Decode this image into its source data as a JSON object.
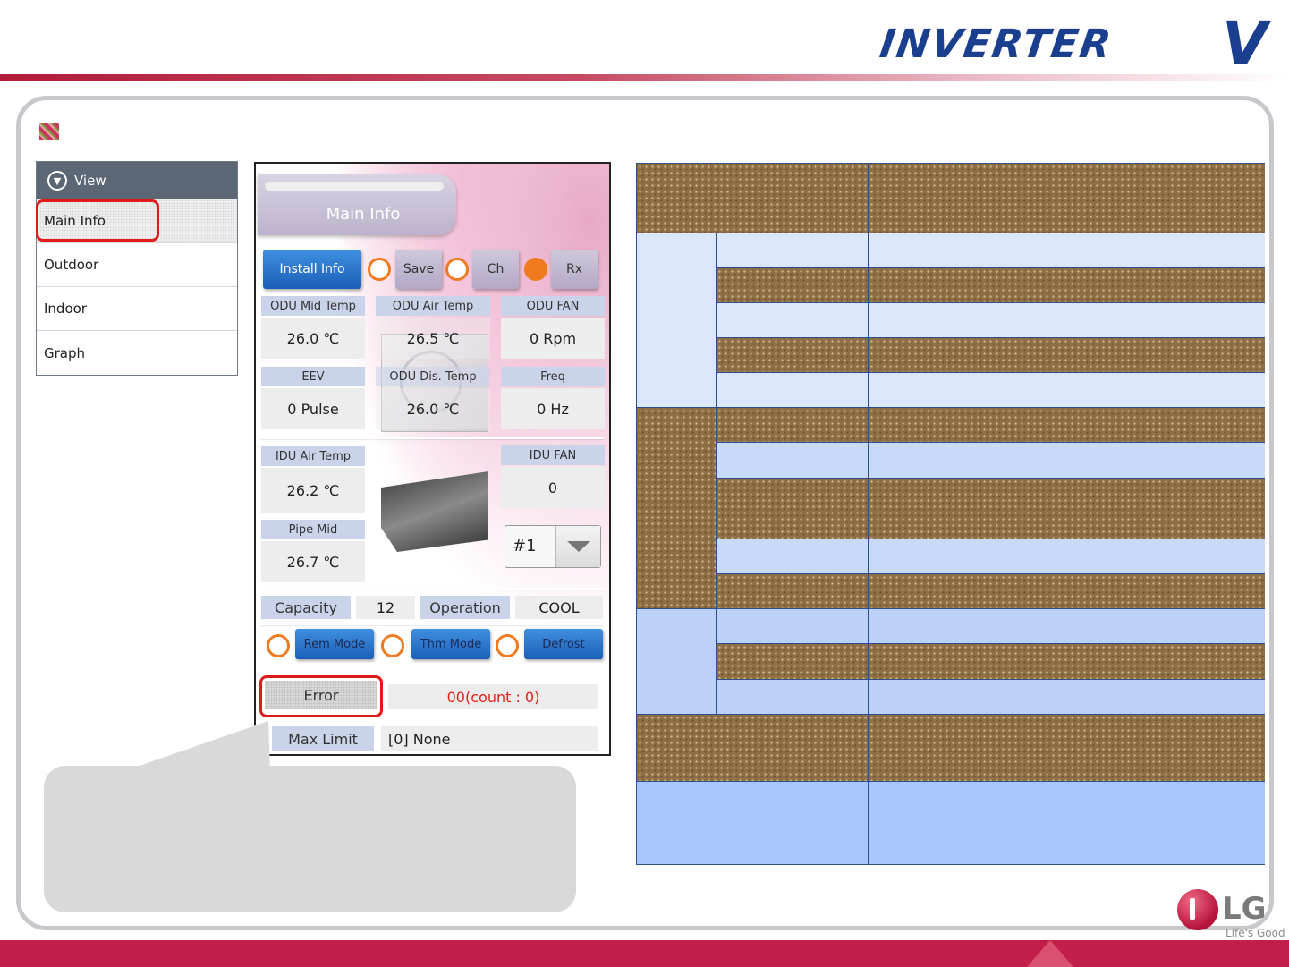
{
  "header": {
    "brand_word": "INVERTER",
    "brand_v": "V"
  },
  "menu": {
    "title": "View",
    "items": [
      {
        "label": "Main Info"
      },
      {
        "label": "Outdoor"
      },
      {
        "label": "Indoor"
      },
      {
        "label": "Graph"
      }
    ]
  },
  "panel": {
    "title": "Main Info",
    "toolbar": {
      "install_info": "Install Info",
      "save": "Save",
      "ch": "Ch",
      "rx": "Rx"
    },
    "odu": {
      "mid_temp_label": "ODU Mid Temp",
      "mid_temp_value": "26.0 ℃",
      "air_temp_label": "ODU Air Temp",
      "air_temp_value": "26.5 ℃",
      "fan_label": "ODU FAN",
      "fan_value": "0 Rpm",
      "eev_label": "EEV",
      "eev_value": "0 Pulse",
      "dis_temp_label": "ODU Dis. Temp",
      "dis_temp_value": "26.0 ℃",
      "freq_label": "Freq",
      "freq_value": "0 Hz"
    },
    "idu": {
      "air_temp_label": "IDU Air Temp",
      "air_temp_value": "26.2 ℃",
      "fan_label": "IDU FAN",
      "fan_value": "0",
      "pipe_mid_label": "Pipe Mid",
      "pipe_mid_value": "26.7 ℃",
      "unit_select": "#1"
    },
    "capacity_label": "Capacity",
    "capacity_value": "12",
    "operation_label": "Operation",
    "operation_value": "COOL",
    "modes": {
      "rem_mode": "Rem Mode",
      "thm_mode": "Thm Mode",
      "defrost": "Defrost"
    },
    "error_label": "Error",
    "error_value": "00(count : 0)",
    "max_limit_label": "Max Limit",
    "max_limit_value": "[0] None"
  },
  "footer": {
    "logo": "LG",
    "tagline": "Life's Good"
  },
  "colors": {
    "accent": "#c21e4a",
    "brand": "#1b3f8f",
    "button_blue": "#1b5fb8",
    "indicator": "#f07a20",
    "highlight": "#e11919"
  }
}
